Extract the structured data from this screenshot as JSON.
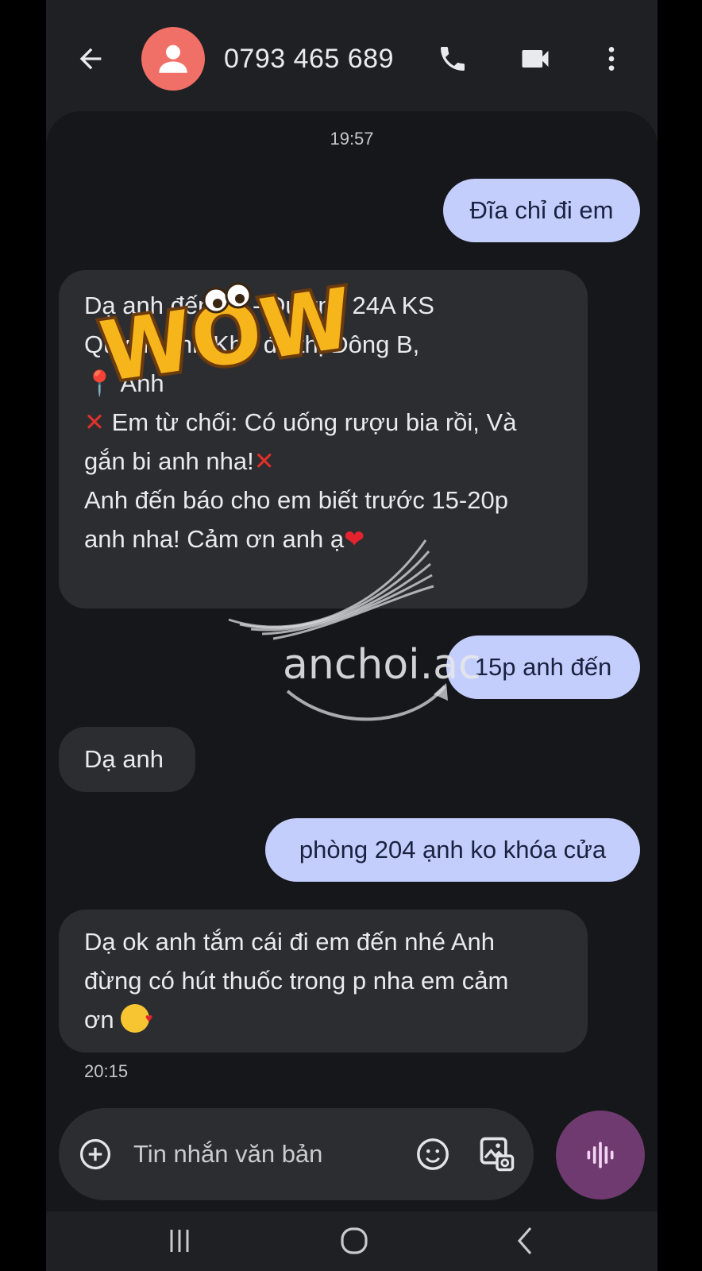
{
  "header": {
    "contact": "0793 465 689",
    "back_icon": "arrow-left-icon",
    "avatar_icon": "person-icon",
    "call_icon": "phone-icon",
    "video_icon": "video-camera-icon",
    "more_icon": "more-vert-icon",
    "avatar_color": "#f07067"
  },
  "thread": {
    "timestamp_top": "19:57",
    "timestamp_bottom": "20:15",
    "messages": [
      {
        "direction": "outgoing",
        "lines": [
          "Đĩa chỉ đi em"
        ]
      },
      {
        "direction": "incoming",
        "lines": [
          "Dạ anh đến 65 - Đường 24A KS",
          "Quỳnh Anh Khu đô thị Đông B,",
          "Anh",
          "Em từ chối: Có uống rượu bia rồi, Và",
          "gắn bi anh nha!",
          "Anh đến báo cho em biết trước 15-20p",
          "anh nha! Cảm ơn anh ạ"
        ]
      },
      {
        "direction": "outgoing",
        "lines": [
          "15p anh đến"
        ]
      },
      {
        "direction": "incoming",
        "lines": [
          "Dạ anh"
        ]
      },
      {
        "direction": "outgoing",
        "lines": [
          "phòng 204 ạnh ko khóa cửa"
        ]
      },
      {
        "direction": "incoming",
        "lines": [
          "Dạ ok anh tắm cái đi em đến nhé Anh",
          "đừng có hút thuốc trong p nha em cảm",
          "ơn"
        ]
      }
    ]
  },
  "overlays": {
    "sticker_text": "WOW",
    "watermark_text": "anchoi.ac"
  },
  "compose": {
    "placeholder": "Tin nhắn văn bản",
    "add_icon": "add-circle-icon",
    "emoji_icon": "emoji-icon",
    "gallery_icon": "gallery-icon",
    "voice_icon": "voice-wave-icon"
  },
  "navbar": {
    "recents_icon": "recents-icon",
    "home_icon": "home-icon",
    "back_icon": "nav-back-icon"
  },
  "colors": {
    "outgoing_bubble": "#c3cefd",
    "incoming_bubble": "#2c2d31",
    "background": "#16171a",
    "voice_button": "#6f3a6f"
  }
}
